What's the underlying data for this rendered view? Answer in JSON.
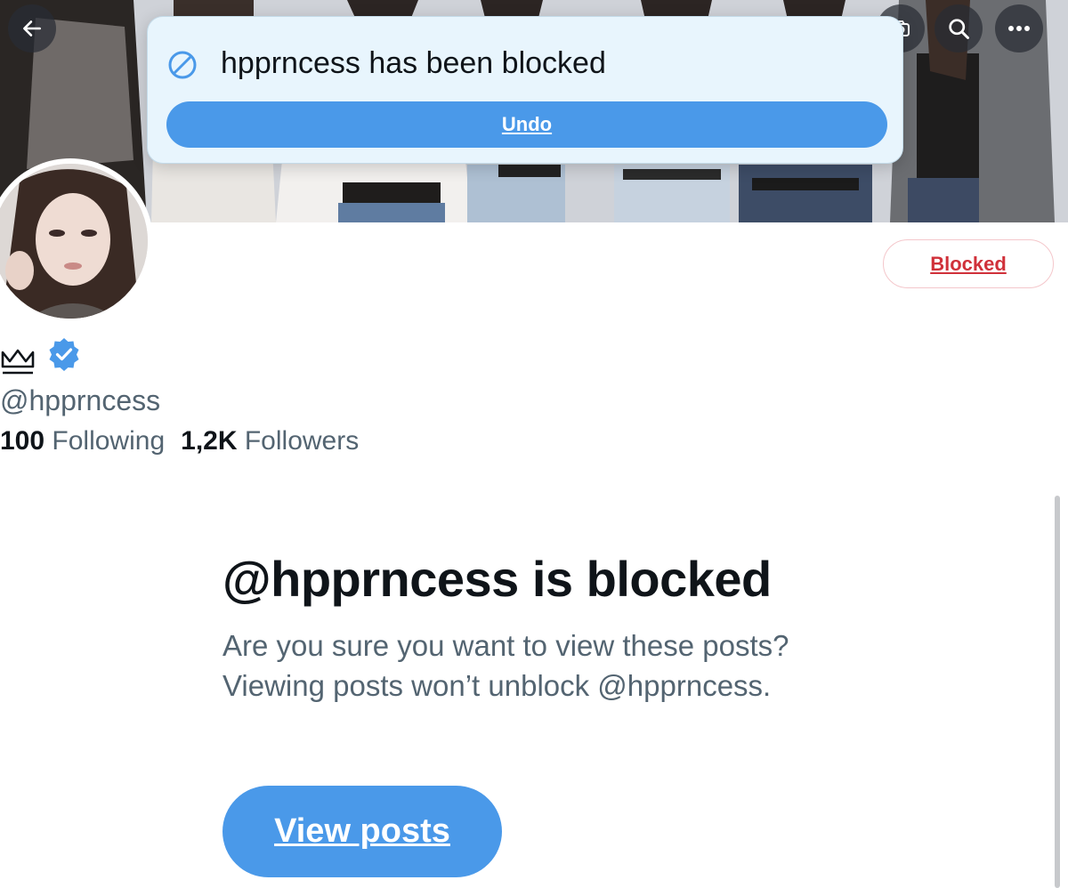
{
  "header": {
    "back_icon": "arrow-left-icon",
    "camera_icon": "camera-icon",
    "search_icon": "search-icon",
    "more_icon": "more-horizontal-icon"
  },
  "toast": {
    "icon": "block-icon",
    "message": "hpprncess has been blocked",
    "undo_label": "Undo"
  },
  "profile": {
    "name_icons": [
      "crown-icon",
      "verified-badge-icon"
    ],
    "handle": "@hpprncess",
    "following_count": "100",
    "following_label": "Following",
    "followers_count": "1,2K",
    "followers_label": "Followers",
    "blocked_button_label": "Blocked"
  },
  "blocked_notice": {
    "title": "@hpprncess is blocked",
    "description": "Are you sure you want to view these posts? Viewing posts won’t unblock @hpprncess.",
    "view_posts_label": "View posts"
  },
  "colors": {
    "accent_blue": "#4a99e9",
    "toast_background": "#e8f5fd",
    "blocked_red": "#d0313a",
    "secondary_text": "#536471",
    "primary_text": "#0f1419"
  }
}
